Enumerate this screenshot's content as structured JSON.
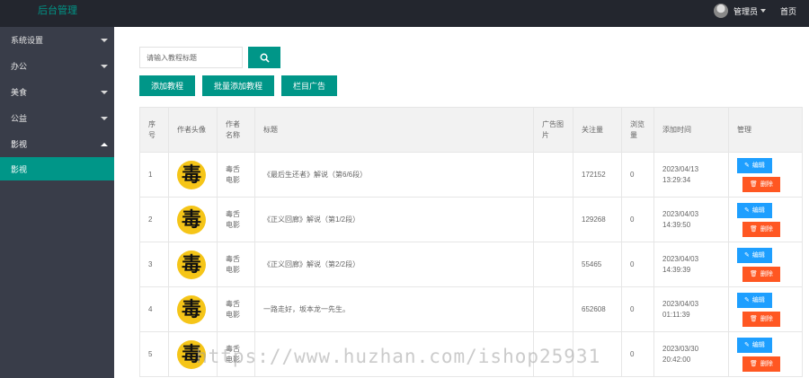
{
  "header": {
    "brand": "后台管理",
    "user": "管理员",
    "home": "首页"
  },
  "sidebar": {
    "items": [
      {
        "label": "系统设置",
        "expanded": false
      },
      {
        "label": "办公",
        "expanded": false
      },
      {
        "label": "美食",
        "expanded": false
      },
      {
        "label": "公益",
        "expanded": false
      },
      {
        "label": "影视",
        "expanded": true
      }
    ],
    "sub_active": "影视"
  },
  "toolbar": {
    "search_placeholder": "请输入教程标题",
    "add_label": "添加教程",
    "batch_add_label": "批量添加教程",
    "column_ad_label": "栏目广告"
  },
  "table": {
    "headers": [
      "序号",
      "作者头像",
      "作者名称",
      "标题",
      "广告图片",
      "关注量",
      "浏览量",
      "添加时间",
      "管理"
    ],
    "edit_label": "编辑",
    "delete_label": "删除",
    "avatar_glyph": "毒",
    "rows": [
      {
        "no": "1",
        "author": "毒舌电影",
        "title": "《最后生还者》解说（第6/6段）",
        "follows": "172152",
        "views": "0",
        "date": "2023/04/13",
        "time": "13:29:34"
      },
      {
        "no": "2",
        "author": "毒舌电影",
        "title": "《正义回廊》解说（第1/2段）",
        "follows": "129268",
        "views": "0",
        "date": "2023/04/03",
        "time": "14:39:50"
      },
      {
        "no": "3",
        "author": "毒舌电影",
        "title": "《正义回廊》解说（第2/2段）",
        "follows": "55465",
        "views": "0",
        "date": "2023/04/03",
        "time": "14:39:39"
      },
      {
        "no": "4",
        "author": "毒舌电影",
        "title": "一路走好，坂本龙一先生。",
        "follows": "652608",
        "views": "0",
        "date": "2023/04/03",
        "time": "01:11:39"
      },
      {
        "no": "5",
        "author": "毒舌电影",
        "title": "",
        "follows": "",
        "views": "0",
        "date": "2023/03/30",
        "time": "20:42:00"
      }
    ]
  },
  "watermark": "https://www.huzhan.com/ishop25931",
  "colors": {
    "topbar": "#23262e",
    "sidebar": "#393d49",
    "primary": "#009688",
    "edit": "#1e9fff",
    "delete": "#ff5722"
  }
}
